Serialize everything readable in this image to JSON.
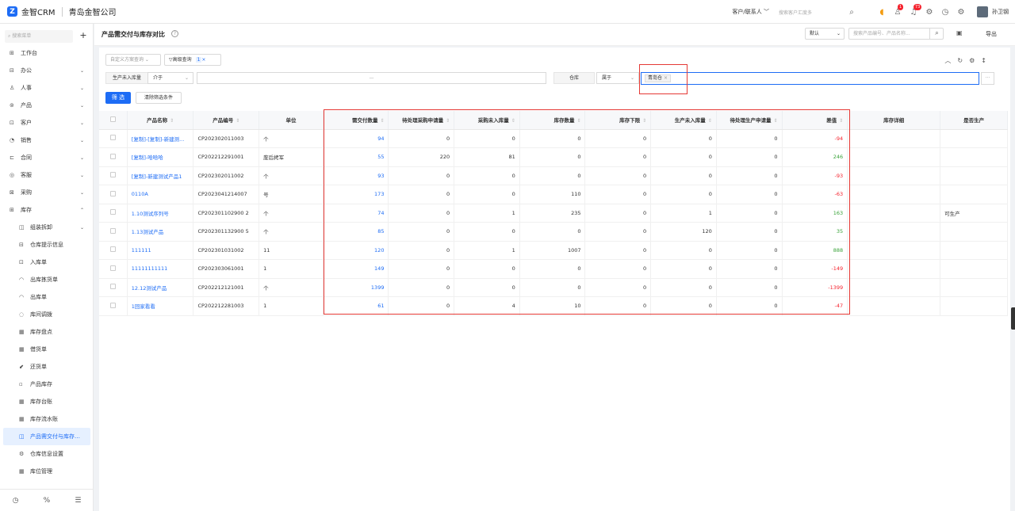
{
  "topbar": {
    "brand": "金智CRM",
    "company": "青岛金智公司",
    "scope": "客户/联系人 ﹀",
    "search_placeholder": "搜索客户汇度多",
    "badge_contacts": "1",
    "badge_notifications": "73",
    "user": "孙卫钢"
  },
  "sidebar": {
    "search_placeholder": "搜索菜单",
    "items": [
      {
        "label": "工作台",
        "icon": "⊞",
        "arrow": ""
      },
      {
        "label": "办公",
        "icon": "⊟",
        "arrow": "⌄"
      },
      {
        "label": "人事",
        "icon": "♙",
        "arrow": "⌄"
      },
      {
        "label": "产品",
        "icon": "⊚",
        "arrow": "⌄"
      },
      {
        "label": "客户",
        "icon": "⊡",
        "arrow": "⌄"
      },
      {
        "label": "销售",
        "icon": "◔",
        "arrow": "⌄"
      },
      {
        "label": "合同",
        "icon": "⊏",
        "arrow": "⌄"
      },
      {
        "label": "客服",
        "icon": "◎",
        "arrow": "⌄"
      },
      {
        "label": "采购",
        "icon": "⊠",
        "arrow": "⌄"
      },
      {
        "label": "库存",
        "icon": "⊞",
        "arrow": "⌃"
      }
    ],
    "sub_items": [
      {
        "label": "组装拆卸",
        "icon": "◫",
        "arrow": "⌄"
      },
      {
        "label": "仓库提示信息",
        "icon": "⊟",
        "arrow": ""
      },
      {
        "label": "入库单",
        "icon": "⊡",
        "arrow": ""
      },
      {
        "label": "出库拣货单",
        "icon": "◠",
        "arrow": ""
      },
      {
        "label": "出库单",
        "icon": "◠",
        "arrow": ""
      },
      {
        "label": "库间调拨",
        "icon": "◌",
        "arrow": ""
      },
      {
        "label": "库存盘点",
        "icon": "▦",
        "arrow": ""
      },
      {
        "label": "借货单",
        "icon": "▦",
        "arrow": ""
      },
      {
        "label": "还货单",
        "icon": "⬋",
        "arrow": ""
      },
      {
        "label": "产品库存",
        "icon": "▫",
        "arrow": ""
      },
      {
        "label": "库存台账",
        "icon": "▦",
        "arrow": ""
      },
      {
        "label": "库存流水账",
        "icon": "▦",
        "arrow": ""
      },
      {
        "label": "产品需交付与库存…",
        "icon": "◫",
        "arrow": "",
        "active": true
      },
      {
        "label": "仓库信息设置",
        "icon": "⚙",
        "arrow": ""
      },
      {
        "label": "库位管理",
        "icon": "▦",
        "arrow": ""
      }
    ]
  },
  "page": {
    "title": "产品需交付与库存对比",
    "sort_value": "默认",
    "search_placeholder": "搜索产品编号、产品名称...",
    "export_label": "导出"
  },
  "filters": {
    "custom_query": "自定义方案查询",
    "advanced": "高级查询",
    "advanced_count": "1",
    "field1_label": "生产未入库量",
    "field1_op": "介于",
    "range_sep": "—",
    "field2_label": "仓库",
    "field2_op": "属于",
    "warehouse_tag": "青岛仓",
    "more": "···",
    "filter_button": "筛 选",
    "clear_button": "清除筛选条件"
  },
  "table": {
    "columns": [
      "",
      "产品名称",
      "产品编号",
      "单位",
      "需交付数量",
      "待处理采购申请量",
      "采购未入库量",
      "库存数量",
      "库存下限",
      "生产未入库量",
      "待处理生产申请量",
      "差值",
      "库存详细",
      "是否生产"
    ],
    "rows": [
      {
        "name": "[复制]-[复制]-新建测...",
        "code": "CP202302011003",
        "unit": "个",
        "demand": "94",
        "pending_purchase": "0",
        "purchase_not_in": "0",
        "stock": "0",
        "min_stock": "0",
        "prod_not_in": "0",
        "pending_prod": "0",
        "diff": "-94",
        "detail": "",
        "producible": ""
      },
      {
        "name": "[复制]-哈哈哈",
        "code": "CP202212291001",
        "unit": "废后拷军",
        "demand": "55",
        "pending_purchase": "220",
        "purchase_not_in": "81",
        "stock": "0",
        "min_stock": "0",
        "prod_not_in": "0",
        "pending_prod": "0",
        "diff": "246",
        "detail": "",
        "producible": ""
      },
      {
        "name": "[复制]-新建测试产品1",
        "code": "CP202302011002",
        "unit": "个",
        "demand": "93",
        "pending_purchase": "0",
        "purchase_not_in": "0",
        "stock": "0",
        "min_stock": "0",
        "prod_not_in": "0",
        "pending_prod": "0",
        "diff": "-93",
        "detail": "",
        "producible": ""
      },
      {
        "name": "0110A",
        "code": "CP2023041214007",
        "unit": "号",
        "demand": "173",
        "pending_purchase": "0",
        "purchase_not_in": "0",
        "stock": "110",
        "min_stock": "0",
        "prod_not_in": "0",
        "pending_prod": "0",
        "diff": "-63",
        "detail": "",
        "producible": ""
      },
      {
        "name": "1.10测试序列号",
        "code": "CP202301102900 2",
        "unit": "个",
        "demand": "74",
        "pending_purchase": "0",
        "purchase_not_in": "1",
        "stock": "235",
        "min_stock": "0",
        "prod_not_in": "1",
        "pending_prod": "0",
        "diff": "163",
        "detail": "",
        "producible": "可生产"
      },
      {
        "name": "1.13测试产品",
        "code": "CP202301132900 5",
        "unit": "个",
        "demand": "85",
        "pending_purchase": "0",
        "purchase_not_in": "0",
        "stock": "0",
        "min_stock": "0",
        "prod_not_in": "120",
        "pending_prod": "0",
        "diff": "35",
        "detail": "",
        "producible": ""
      },
      {
        "name": "111111",
        "code": "CP202301031002",
        "unit": "11",
        "demand": "120",
        "pending_purchase": "0",
        "purchase_not_in": "1",
        "stock": "1007",
        "min_stock": "0",
        "prod_not_in": "0",
        "pending_prod": "0",
        "diff": "888",
        "detail": "",
        "producible": ""
      },
      {
        "name": "11111111111",
        "code": "CP202303061001",
        "unit": "1",
        "demand": "149",
        "pending_purchase": "0",
        "purchase_not_in": "0",
        "stock": "0",
        "min_stock": "0",
        "prod_not_in": "0",
        "pending_prod": "0",
        "diff": "-149",
        "detail": "",
        "producible": ""
      },
      {
        "name": "12.12测试产品",
        "code": "CP202212121001",
        "unit": "个",
        "demand": "1399",
        "pending_purchase": "0",
        "purchase_not_in": "0",
        "stock": "0",
        "min_stock": "0",
        "prod_not_in": "0",
        "pending_prod": "0",
        "diff": "-1399",
        "detail": "",
        "producible": ""
      },
      {
        "name": "1回家看看",
        "code": "CP202212281003",
        "unit": "1",
        "demand": "61",
        "pending_purchase": "0",
        "purchase_not_in": "4",
        "stock": "10",
        "min_stock": "0",
        "prod_not_in": "0",
        "pending_prod": "0",
        "diff": "-47",
        "detail": "",
        "producible": ""
      }
    ]
  },
  "colors": {
    "accent": "#1d6cf5",
    "negative": "#f5222d",
    "positive": "#3aa33a",
    "annotation": "#e53935"
  }
}
